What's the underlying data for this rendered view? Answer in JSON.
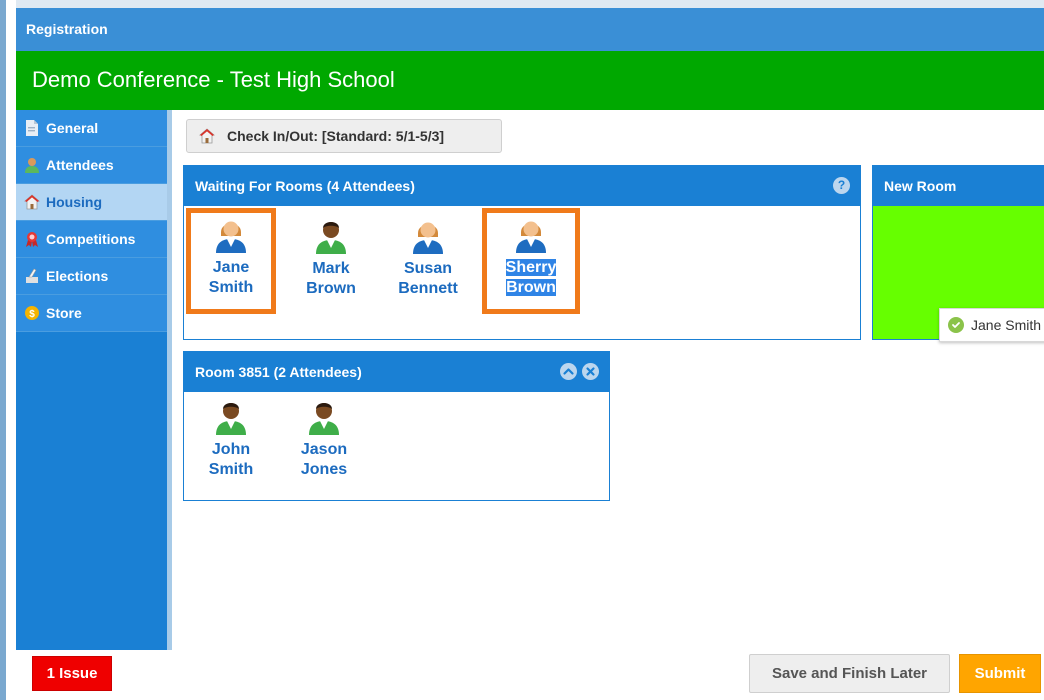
{
  "window": {
    "title": "Registration"
  },
  "header": {
    "conference_title": "Demo Conference - Test High School"
  },
  "sidebar": {
    "items": [
      {
        "label": "General",
        "icon": "document-icon"
      },
      {
        "label": "Attendees",
        "icon": "person-icon"
      },
      {
        "label": "Housing",
        "icon": "house-icon",
        "active": true
      },
      {
        "label": "Competitions",
        "icon": "ribbon-icon"
      },
      {
        "label": "Elections",
        "icon": "ballot-icon"
      },
      {
        "label": "Store",
        "icon": "coin-icon"
      }
    ]
  },
  "toolbar": {
    "checkin_label": "Check In/Out: [Standard: 5/1-5/3]"
  },
  "waiting_panel": {
    "title": "Waiting For Rooms (4 Attendees)",
    "attendees": [
      {
        "first": "Jane",
        "last": "Smith",
        "gender": "female"
      },
      {
        "first": "Mark",
        "last": "Brown",
        "gender": "male"
      },
      {
        "first": "Susan",
        "last": "Bennett",
        "gender": "female"
      },
      {
        "first": "Sherry",
        "last": "Brown",
        "gender": "female"
      }
    ]
  },
  "new_room_panel": {
    "title": "New Room",
    "drop_tooltip": "Jane Smith"
  },
  "room_panel": {
    "title": "Room 3851 (2 Attendees)",
    "attendees": [
      {
        "first": "John",
        "last": "Smith",
        "gender": "male"
      },
      {
        "first": "Jason",
        "last": "Jones",
        "gender": "male"
      }
    ]
  },
  "footer": {
    "issue_label": "1 Issue",
    "save_label": "Save and Finish Later",
    "submit_label": "Submit"
  },
  "colors": {
    "title_bar": "#3a8fd6",
    "header_green": "#00a800",
    "sidebar_blue": "#1a80d4",
    "drop_zone_green": "#66ff00",
    "highlight_orange": "#f07a1a",
    "issue_red": "#ef0000",
    "submit_orange": "#ffa500"
  }
}
